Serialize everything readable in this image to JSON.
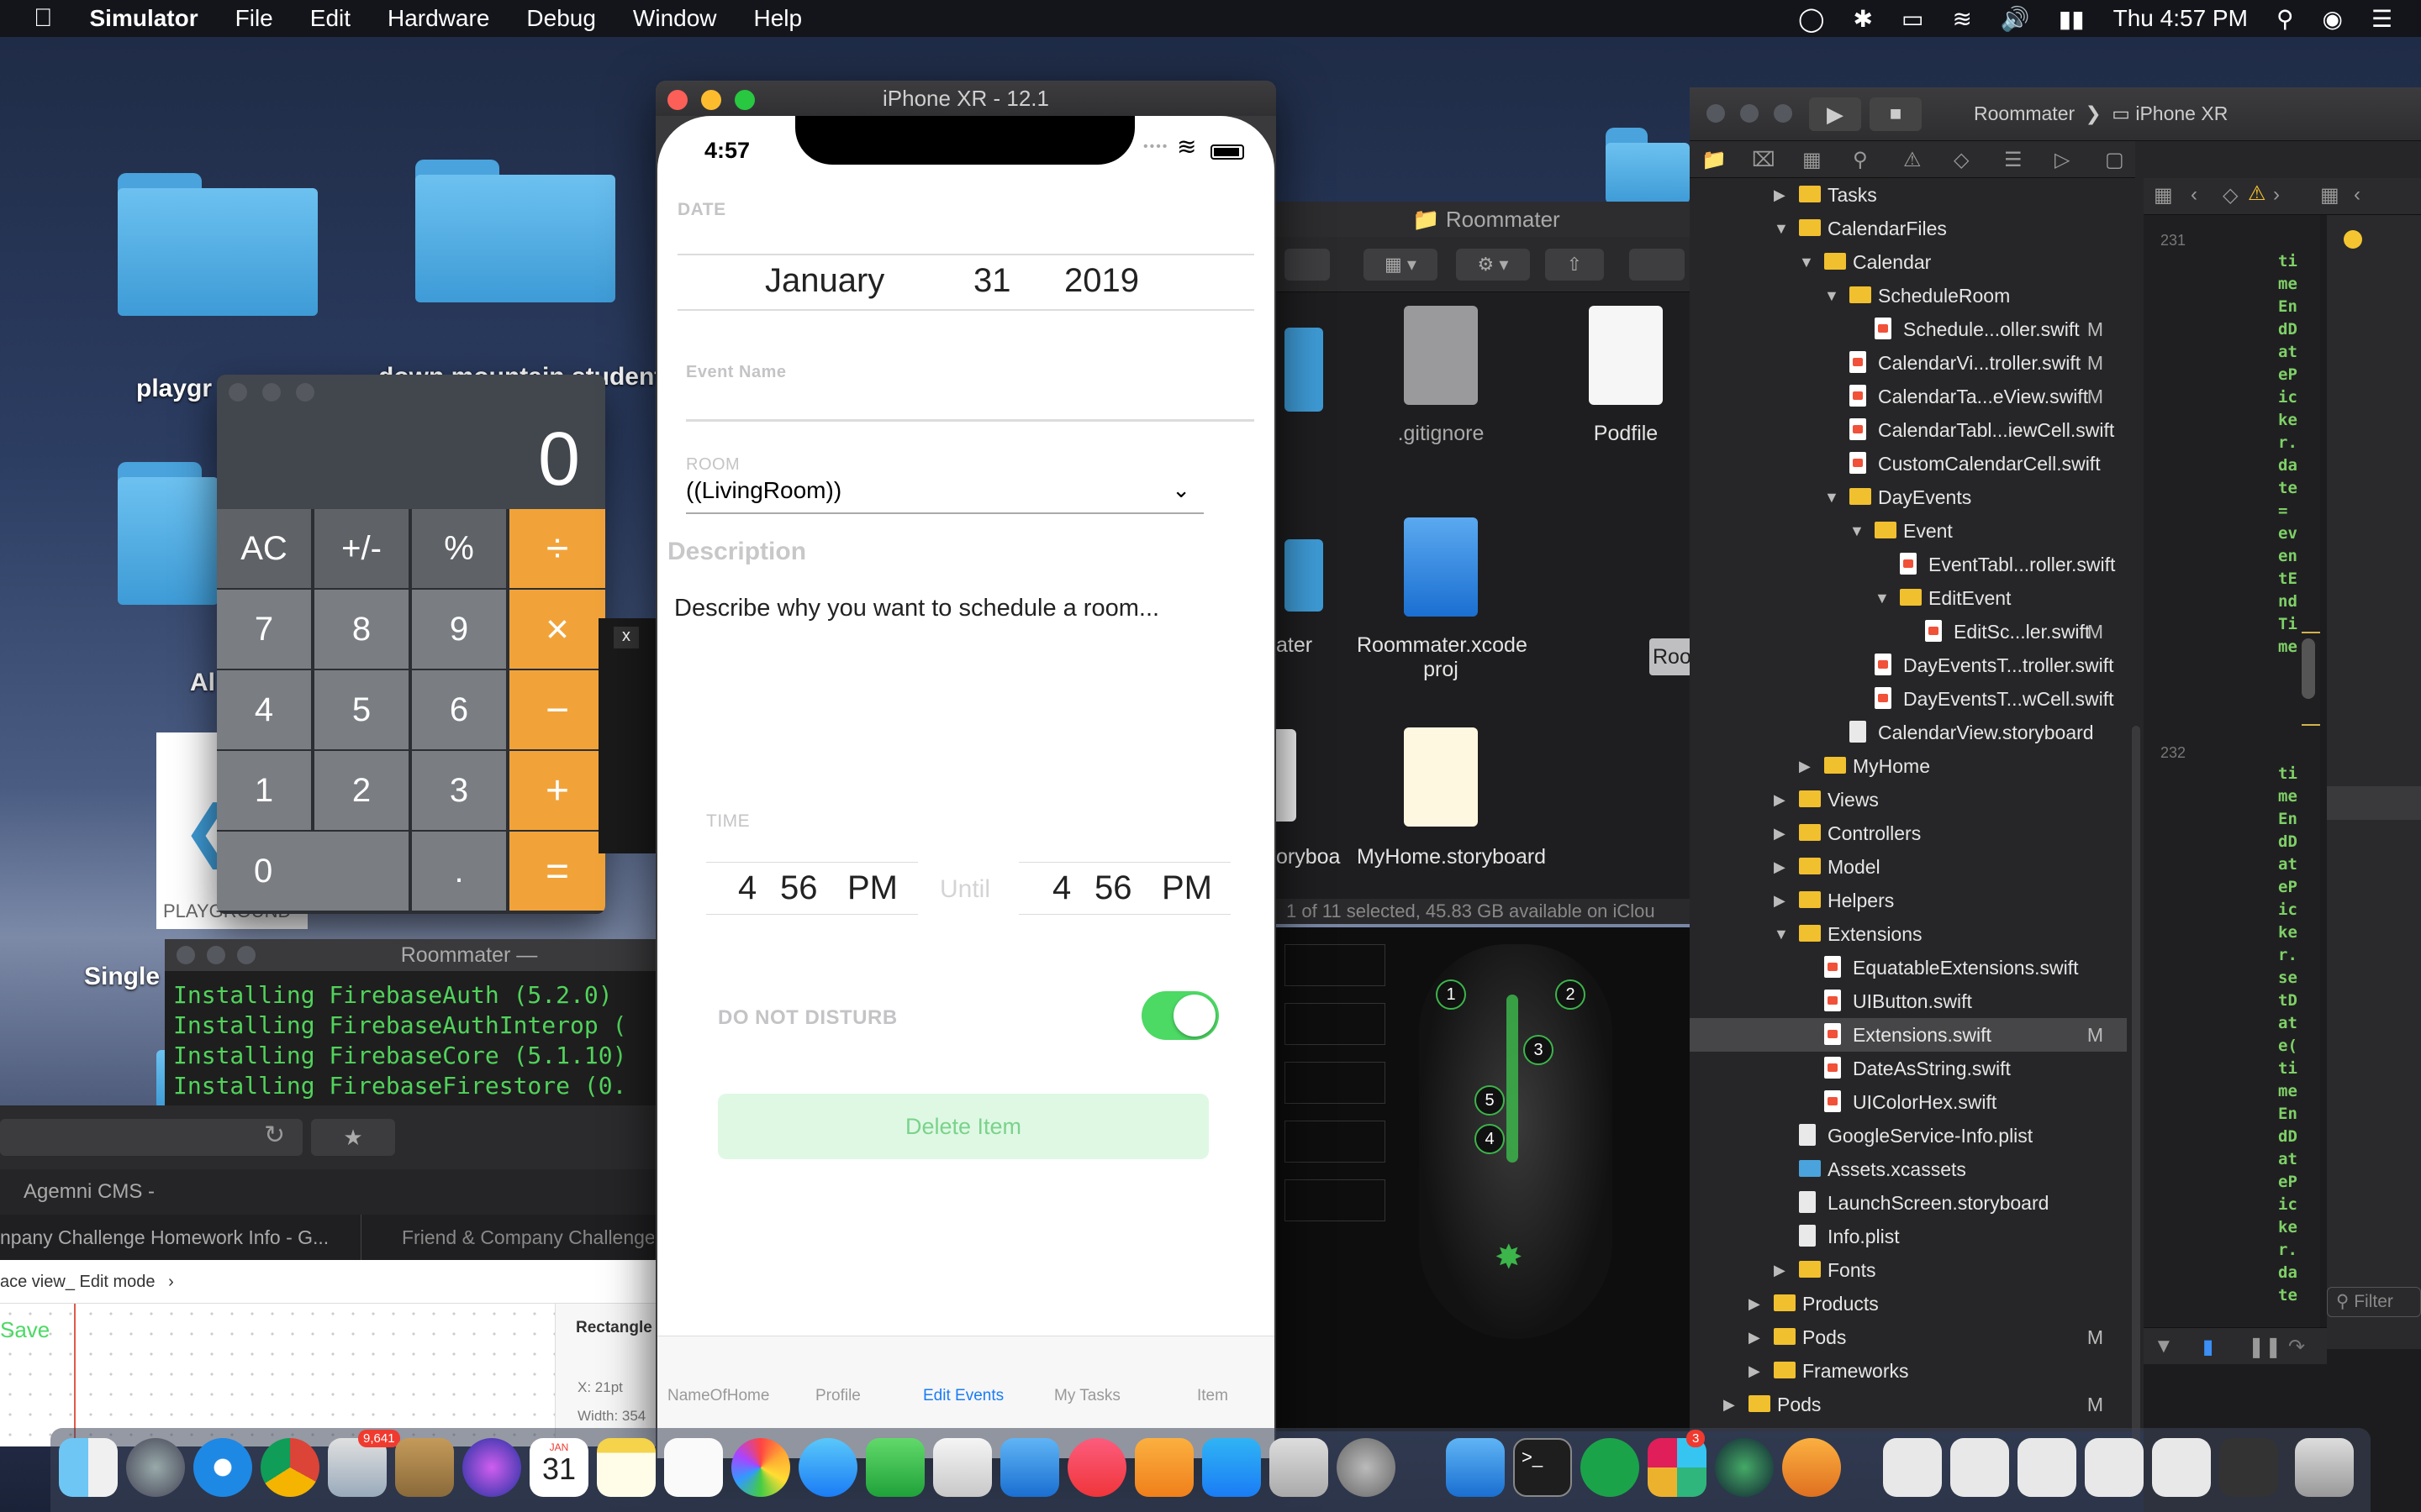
{
  "menubar": {
    "app": "Simulator",
    "items": [
      "File",
      "Edit",
      "Hardware",
      "Debug",
      "Window",
      "Help"
    ],
    "clock": "Thu 4:57 PM"
  },
  "desktop": {
    "labels": [
      "playgr",
      "Al",
      "Single"
    ],
    "label_top_right": "down mountain students",
    "playground_label": "PLAYGROUND"
  },
  "calculator": {
    "display": "0",
    "keys": [
      "AC",
      "+/-",
      "%",
      "÷",
      "7",
      "8",
      "9",
      "×",
      "4",
      "5",
      "6",
      "−",
      "1",
      "2",
      "3",
      "+",
      "0",
      ".",
      "="
    ]
  },
  "simulator": {
    "title": "iPhone XR - 12.1",
    "status_time": "4:57",
    "date_label": "DATE",
    "date_month": "January",
    "date_day": "31",
    "date_year": "2019",
    "event_name_label": "Event Name",
    "room_label": "ROOM",
    "room_value": "((LivingRoom))",
    "description_label": "Description",
    "description_placeholder": "Describe why you want to schedule a room...",
    "time_label": "TIME",
    "start_hour": "4",
    "start_min": "56",
    "start_ampm": "PM",
    "until_label": "Until",
    "end_hour": "4",
    "end_min": "56",
    "end_ampm": "PM",
    "dnd_label": "DO NOT DISTURB",
    "dnd_on": true,
    "delete_label": "Delete Item",
    "tabs": [
      "NameOfHome",
      "Profile",
      "Edit Events",
      "My Tasks",
      "Item"
    ],
    "active_tab": "Edit Events",
    "accent": "#4cd964"
  },
  "finder": {
    "title": "Roommater",
    "files": [
      ".gitignore",
      "Podfile",
      "Roommater.xcode proj",
      "MyHome.storyboard"
    ],
    "partial_labels": [
      "ater",
      "oryboa",
      "Roo"
    ],
    "status": "1 of 11 selected, 45.83 GB available on iClou"
  },
  "terminal": {
    "title": "Roommater —",
    "lines": [
      "Installing FirebaseAuth (5.2.0)",
      "Installing FirebaseAuthInterop (",
      "Installing FirebaseCore (5.1.10)",
      "Installing FirebaseFirestore (0."
    ]
  },
  "browser": {
    "bookmark": "Agemni CMS -",
    "tab1": "npany Challenge Homework Info - G...",
    "tab2": "Friend & Company Challenge",
    "breadcrumb": "ace view_ Edit mode",
    "save": "Save",
    "panel_title": "Rectangle",
    "x_value": "X: 21pt",
    "width_value": "Width: 354"
  },
  "xcode": {
    "scheme": "Roommater",
    "device": "iPhone XR",
    "filter_placeholder": "Filter",
    "line_numbers": [
      "231",
      "232"
    ],
    "tree": [
      {
        "name": "Tasks",
        "indent": 0,
        "kind": "folder",
        "open": false
      },
      {
        "name": "CalendarFiles",
        "indent": 0,
        "kind": "folder",
        "open": true
      },
      {
        "name": "Calendar",
        "indent": 1,
        "kind": "folder",
        "open": true
      },
      {
        "name": "ScheduleRoom",
        "indent": 2,
        "kind": "folder",
        "open": true
      },
      {
        "name": "Schedule...oller.swift",
        "indent": 3,
        "kind": "swift",
        "m": "M"
      },
      {
        "name": "CalendarVi...troller.swift",
        "indent": 2,
        "kind": "swift",
        "m": "M"
      },
      {
        "name": "CalendarTa...eView.swift",
        "indent": 2,
        "kind": "swift",
        "m": "M"
      },
      {
        "name": "CalendarTabl...iewCell.swift",
        "indent": 2,
        "kind": "swift"
      },
      {
        "name": "CustomCalendarCell.swift",
        "indent": 2,
        "kind": "swift"
      },
      {
        "name": "DayEvents",
        "indent": 2,
        "kind": "folder",
        "open": true
      },
      {
        "name": "Event",
        "indent": 3,
        "kind": "folder",
        "open": true
      },
      {
        "name": "EventTabl...roller.swift",
        "indent": 4,
        "kind": "swift"
      },
      {
        "name": "EditEvent",
        "indent": 4,
        "kind": "folder",
        "open": true
      },
      {
        "name": "EditSc...ler.swift",
        "indent": 5,
        "kind": "swift",
        "m": "M"
      },
      {
        "name": "DayEventsT...troller.swift",
        "indent": 3,
        "kind": "swift"
      },
      {
        "name": "DayEventsT...wCell.swift",
        "indent": 3,
        "kind": "swift"
      },
      {
        "name": "CalendarView.storyboard",
        "indent": 2,
        "kind": "plist"
      },
      {
        "name": "MyHome",
        "indent": 1,
        "kind": "folder",
        "open": false
      },
      {
        "name": "Views",
        "indent": 0,
        "kind": "folder",
        "open": false
      },
      {
        "name": "Controllers",
        "indent": 0,
        "kind": "folder",
        "open": false
      },
      {
        "name": "Model",
        "indent": 0,
        "kind": "folder",
        "open": false
      },
      {
        "name": "Helpers",
        "indent": 0,
        "kind": "folder",
        "open": false
      },
      {
        "name": "Extensions",
        "indent": 0,
        "kind": "folder",
        "open": true
      },
      {
        "name": "EquatableExtensions.swift",
        "indent": 1,
        "kind": "swift"
      },
      {
        "name": "UIButton.swift",
        "indent": 1,
        "kind": "swift"
      },
      {
        "name": "Extensions.swift",
        "indent": 1,
        "kind": "swift",
        "m": "M",
        "selected": true
      },
      {
        "name": "DateAsString.swift",
        "indent": 1,
        "kind": "swift"
      },
      {
        "name": "UIColorHex.swift",
        "indent": 1,
        "kind": "swift"
      },
      {
        "name": "GoogleService-Info.plist",
        "indent": 0,
        "kind": "plist"
      },
      {
        "name": "Assets.xcassets",
        "indent": 0,
        "kind": "folderblue"
      },
      {
        "name": "LaunchScreen.storyboard",
        "indent": 0,
        "kind": "plist"
      },
      {
        "name": "Info.plist",
        "indent": 0,
        "kind": "plist"
      },
      {
        "name": "Fonts",
        "indent": 0,
        "kind": "folder",
        "open": false
      },
      {
        "name": "Products",
        "indent": -1,
        "kind": "folder",
        "open": false
      },
      {
        "name": "Pods",
        "indent": -1,
        "kind": "folder",
        "open": false,
        "m": "M"
      },
      {
        "name": "Frameworks",
        "indent": -1,
        "kind": "folder",
        "open": false
      },
      {
        "name": "Pods",
        "indent": -2,
        "kind": "folder",
        "open": false,
        "m": "M"
      }
    ],
    "code_col1": [
      "ti",
      "me",
      "En",
      "dD",
      "at",
      "eP",
      "ic",
      "ke",
      "r.",
      "da",
      "te",
      "=",
      "ev",
      "en",
      "tE",
      "nd",
      "Ti",
      "me"
    ],
    "code_col2": [
      "ti",
      "me",
      "En",
      "dD",
      "at",
      "eP",
      "ic",
      "ke",
      "r.",
      "se",
      "tD",
      "at",
      "e(",
      "ti",
      "me",
      "En",
      "dD",
      "at",
      "eP",
      "ic",
      "ke",
      "r.",
      "da",
      "te"
    ]
  },
  "dock": {
    "badge_mail": "9,641",
    "badge_slack": "3",
    "calendar_day": "31",
    "calendar_month": "JAN"
  }
}
